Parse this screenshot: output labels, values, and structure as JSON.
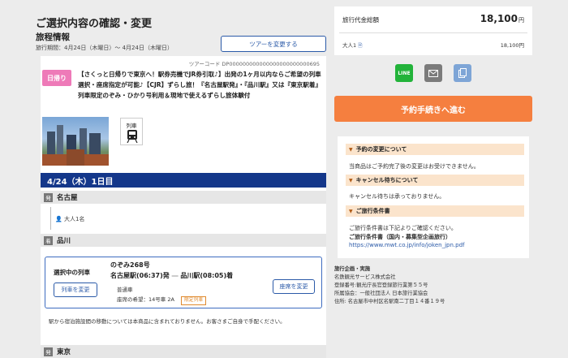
{
  "header": {
    "page_title": "ご選択内容の確認・変更",
    "section_title": "旅程情報",
    "period": "旅行期間：4月24日（木曜日）～ 4月24日（木曜日）",
    "change_tour_label": "ツアーを変更する"
  },
  "tour": {
    "code": "ツアーコード DP000000000000000000000000695",
    "badge": "日帰り",
    "name": "【さくっと日帰りで東京へ！駅券売機でJR券引取♪】出発の1ヶ月以内ならご希望の列車選択・座席指定が可能♪【CJR】ずらし旅！『名古屋駅発』・『品川駅』又は『東京駅着』　列車限定のぞみ・ひかり号利用＆現地で使えるずらし旅体験付",
    "transport_label": "列車"
  },
  "day": {
    "label": "4/24（木）1日目"
  },
  "stations": [
    {
      "badge": "発",
      "name": "名古屋"
    },
    {
      "badge": "着",
      "name": "品川"
    },
    {
      "badge": "発",
      "name": "東京"
    }
  ],
  "passengers": "大人1名",
  "train": {
    "selected_label": "選択中の列車",
    "change_train_label": "列車を変更",
    "number": "のぞみ268号",
    "departure": "名古屋駅(06:37)発",
    "arrival": "品川駅(08:05)着",
    "type": "普通車",
    "seat_pref": "座席の希望：14号車 2A",
    "limited_badge": "限定列車",
    "change_seat_label": "座席を変更"
  },
  "note": "駅から宿泊施設間の移動については本商品に含まれておりません。お客さまご自身で手配ください。",
  "price": {
    "label": "旅行代金総額",
    "total": "18,100",
    "currency": "円",
    "adult_label": "大人1",
    "adult_price": "18,100円"
  },
  "share": {
    "line": "LINE"
  },
  "proceed_label": "予約手続きへ進む",
  "info": {
    "change_title": "予約の変更について",
    "change_text": "当商品はご予約完了後の変更はお受けできません。",
    "cancel_title": "キャンセル待ちについて",
    "cancel_text": "キャンセル待ちは承っておりません。",
    "terms_title": "ご旅行条件書",
    "terms_text": "ご旅行条件書は下記よりご確認ください。",
    "terms_sub": "ご旅行条件書（国内・募集型企画旅行）",
    "terms_url": "https://www.mwt.co.jp/info/joken_jpn.pdf"
  },
  "footer": {
    "l1": "旅行企画・実施",
    "l2": "名鉄観光サービス株式会社",
    "l3": "登録番号:観光庁長官登録旅行業第５５号",
    "l4": "所属協会：一般社団法人 日本旅行業協会",
    "l5": "住所: 名古屋市中村区名駅南二丁目１４番１９号"
  },
  "colors": {
    "accent": "#f57f3f",
    "date_bar": "#14378a",
    "badge_pink": "#ee7ab8",
    "link": "#2b5aa8"
  }
}
